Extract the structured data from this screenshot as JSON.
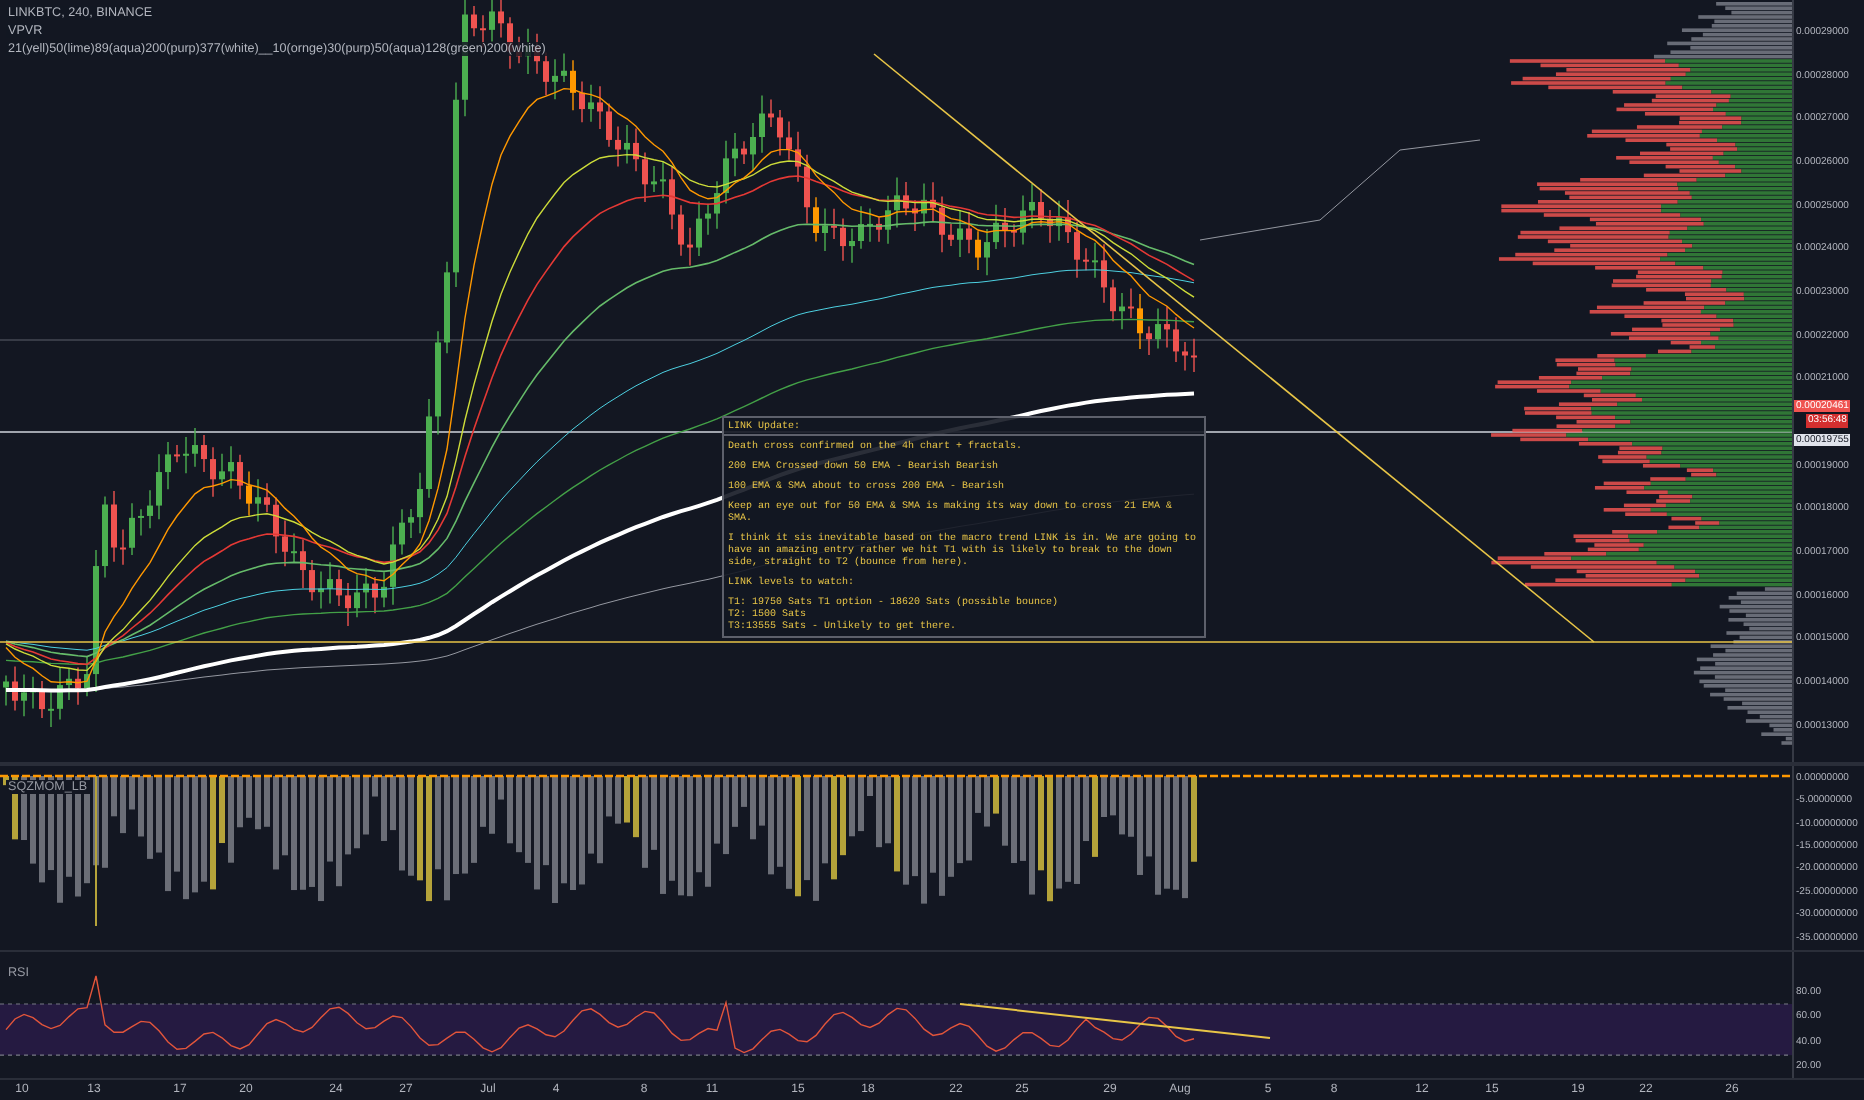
{
  "legend": {
    "symbol": "LINKBTC, 240, BINANCE",
    "indicators": [
      "VPVR",
      "21(yell)50(lime)89(aqua)200(purp)377(white)__10(ornge)30(purp)50(aqua)128(green)200(white)"
    ]
  },
  "price_axis": {
    "upper_labels": [
      "0.00029000",
      "0.00028000",
      "0.00027000",
      "0.00026000",
      "0.00025000",
      "0.00024000",
      "0.00023000",
      "0.00022000",
      "0.00021000"
    ],
    "badges": [
      {
        "kind": "last",
        "text": "0.00020461"
      },
      {
        "kind": "countdown",
        "text": "03:56:48"
      },
      {
        "kind": "line",
        "text": "0.00019755"
      }
    ],
    "lower_labels": [
      "0.00019000",
      "0.00018000",
      "0.00017000",
      "0.00016000",
      "0.00015000",
      "0.00014000",
      "0.00013000"
    ]
  },
  "note": {
    "title": "LINK Update:",
    "lines": [
      "Death cross confirmed on the 4h chart + fractals.",
      "200 EMA Crossed down 50 EMA - Bearish Bearish",
      "100 EMA & SMA about to cross 200 EMA - Bearish",
      "Keep an eye out for 50 EMA & SMA is making its way down to cross  21 EMA & SMA.",
      "I think it sis inevitable based on the macro trend LINK is in. We are going to have an amazing entry rather we hit T1 with is likely to break to the down side, straight to T2 (bounce from here).",
      "LINK levels to watch:"
    ],
    "targets": [
      "T1: 19750 Sats T1 option - 18620 Sats (possible bounce)",
      "T2: 1500 Sats",
      "T3:13555 Sats - Unlikely to get there."
    ]
  },
  "oscillator": {
    "label": "SQZMOM_LB",
    "axis_labels": [
      "0.00000000",
      "-5.00000000",
      "-10.00000000",
      "-15.00000000",
      "-20.00000000",
      "-25.00000000",
      "-30.00000000",
      "-35.00000000"
    ]
  },
  "rsi": {
    "label": "RSI",
    "axis_labels": [
      "80.00",
      "60.00",
      "40.00",
      "20.00"
    ]
  },
  "time_axis": {
    "labels": [
      "10",
      "13",
      "17",
      "20",
      "24",
      "27",
      "Jul",
      "4",
      "8",
      "11",
      "15",
      "18",
      "22",
      "25",
      "29",
      "Aug",
      "5",
      "8",
      "12",
      "15",
      "19",
      "22",
      "26"
    ]
  }
}
